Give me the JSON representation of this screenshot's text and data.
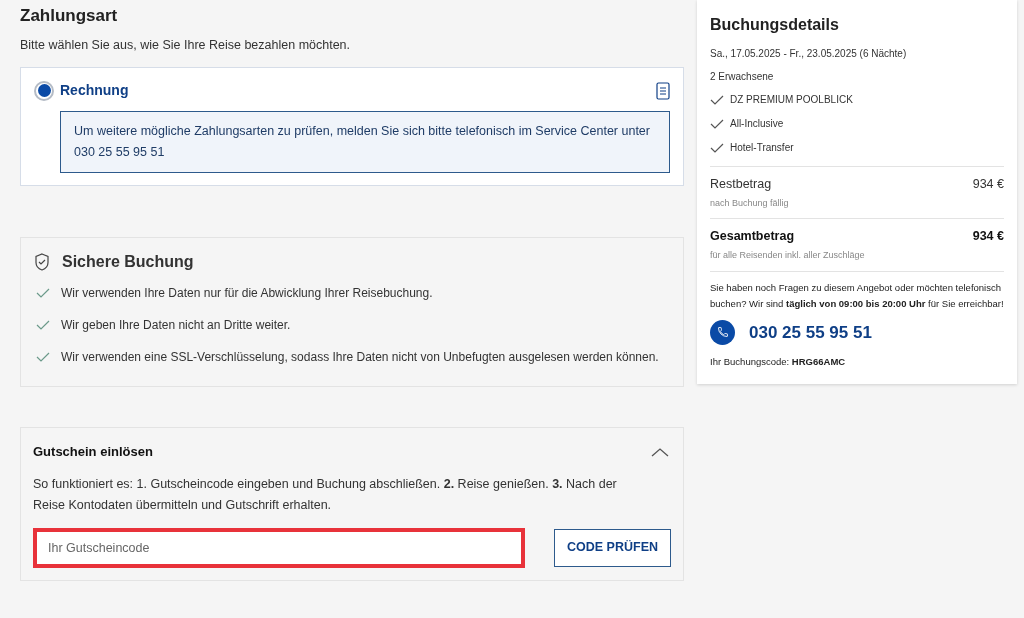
{
  "payment": {
    "title": "Zahlungsart",
    "subtitle": "Bitte wählen Sie aus, wie Sie Ihre Reise bezahlen möchten.",
    "options": [
      {
        "label": "Rechnung",
        "selected": true,
        "info": "Um weitere mögliche Zahlungsarten zu prüfen, melden Sie sich bitte telefonisch im Service Center unter 030 25 55 95 51"
      }
    ]
  },
  "secure": {
    "title": "Sichere Buchung",
    "items": [
      "Wir verwenden Ihre Daten nur für die Abwicklung Ihrer Reisebuchung.",
      "Wir geben Ihre Daten nicht an Dritte weiter.",
      "Wir verwenden eine SSL-Verschlüsselung, sodass Ihre Daten nicht von Unbefugten ausgelesen werden können."
    ]
  },
  "voucher": {
    "title": "Gutschein einlösen",
    "expanded": true,
    "text": "So funktioniert es: 1. Gutscheincode eingeben und Buchung abschließen. **2.** Reise genießen. **3.** Nach der Reise Kontodaten übermitteln und Gutschrift erhalten.",
    "placeholder": "Ihr Gutscheincode",
    "highlighted": true,
    "button": "CODE PRÜFEN"
  },
  "booking": {
    "title": "Buchungsdetails",
    "dates": "Sa., 17.05.2025 - Fr., 23.05.2025 (6 Nächte)",
    "travellers": "2 Erwachsene",
    "features": [
      "DZ PREMIUM POOLBLICK",
      "All-Inclusive",
      "Hotel-Transfer"
    ],
    "totals": [
      {
        "label": "Restbetrag",
        "note": "nach Buchung fällig",
        "amount": "934 €",
        "emphasis": false
      },
      {
        "label": "Gesamtbetrag",
        "note": "für alle Reisenden inkl. aller Zuschläge",
        "amount": "934 €",
        "emphasis": true
      }
    ],
    "contact_text": "Sie haben noch Fragen zu diesem Angebot oder möchten telefonisch buchen? Wir sind **täglich von 09:00 bis 20:00 Uhr** für Sie erreichbar!",
    "phone": "030 25 55 95 51",
    "code": "Ihr Buchungscode: **HRG66AMC**"
  }
}
